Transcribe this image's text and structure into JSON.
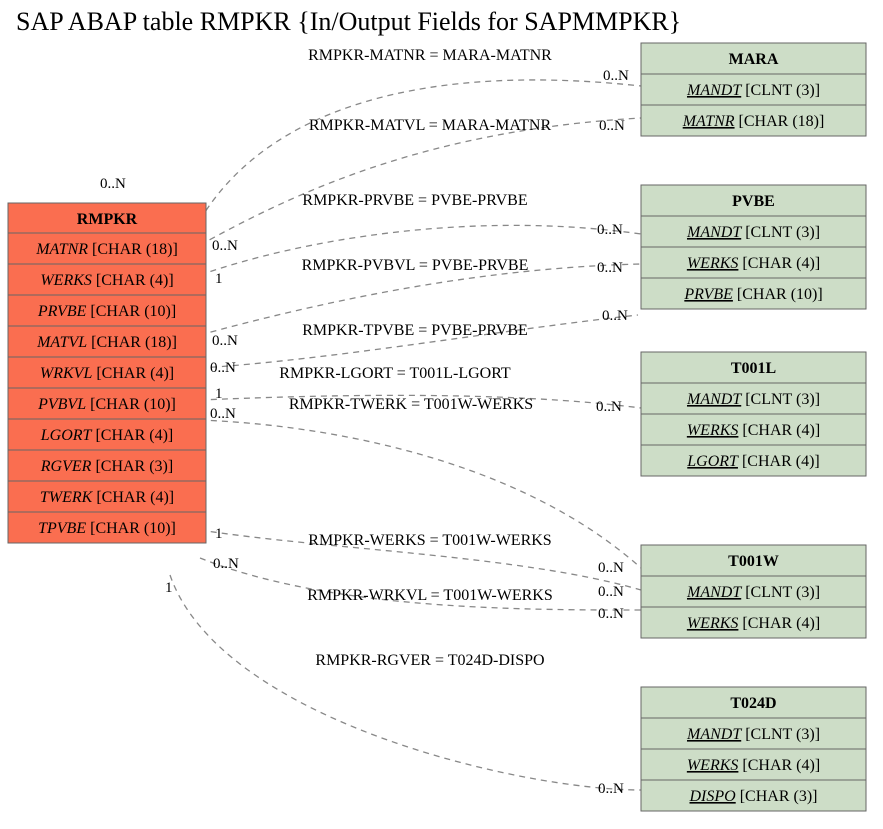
{
  "title": "SAP ABAP table RMPKR {In/Output Fields for SAPMMPKR}",
  "main_table": {
    "name": "RMPKR",
    "fields": [
      {
        "name": "MATNR",
        "type": "[CHAR (18)]"
      },
      {
        "name": "WERKS",
        "type": "[CHAR (4)]"
      },
      {
        "name": "PRVBE",
        "type": "[CHAR (10)]"
      },
      {
        "name": "MATVL",
        "type": "[CHAR (18)]"
      },
      {
        "name": "WRKVL",
        "type": "[CHAR (4)]"
      },
      {
        "name": "PVBVL",
        "type": "[CHAR (10)]"
      },
      {
        "name": "LGORT",
        "type": "[CHAR (4)]"
      },
      {
        "name": "RGVER",
        "type": "[CHAR (3)]"
      },
      {
        "name": "TWERK",
        "type": "[CHAR (4)]"
      },
      {
        "name": "TPVBE",
        "type": "[CHAR (10)]"
      }
    ]
  },
  "ref_tables": [
    {
      "name": "MARA",
      "fields": [
        {
          "name": "MANDT",
          "type": "[CLNT (3)]"
        },
        {
          "name": "MATNR",
          "type": "[CHAR (18)]"
        }
      ]
    },
    {
      "name": "PVBE",
      "fields": [
        {
          "name": "MANDT",
          "type": "[CLNT (3)]"
        },
        {
          "name": "WERKS",
          "type": "[CHAR (4)]"
        },
        {
          "name": "PRVBE",
          "type": "[CHAR (10)]"
        }
      ]
    },
    {
      "name": "T001L",
      "fields": [
        {
          "name": "MANDT",
          "type": "[CLNT (3)]"
        },
        {
          "name": "WERKS",
          "type": "[CHAR (4)]"
        },
        {
          "name": "LGORT",
          "type": "[CHAR (4)]"
        }
      ]
    },
    {
      "name": "T001W",
      "fields": [
        {
          "name": "MANDT",
          "type": "[CLNT (3)]"
        },
        {
          "name": "WERKS",
          "type": "[CHAR (4)]"
        }
      ]
    },
    {
      "name": "T024D",
      "fields": [
        {
          "name": "MANDT",
          "type": "[CLNT (3)]"
        },
        {
          "name": "WERKS",
          "type": "[CHAR (4)]"
        },
        {
          "name": "DISPO",
          "type": "[CHAR (3)]"
        }
      ]
    }
  ],
  "relations": [
    {
      "label": "RMPKR-MATNR = MARA-MATNR",
      "left_card": "0..N",
      "right_card": "0..N"
    },
    {
      "label": "RMPKR-MATVL = MARA-MATNR",
      "left_card": "0..N",
      "right_card": "0..N"
    },
    {
      "label": "RMPKR-PRVBE = PVBE-PRVBE",
      "left_card": "1",
      "right_card": "0..N"
    },
    {
      "label": "RMPKR-PVBVL = PVBE-PRVBE",
      "left_card": "0..N",
      "right_card": "0..N"
    },
    {
      "label": "RMPKR-TPVBE = PVBE-PRVBE",
      "left_card": "0..N",
      "right_card": "0..N"
    },
    {
      "label": "RMPKR-LGORT = T001L-LGORT",
      "left_card": "1",
      "right_card": "0..N"
    },
    {
      "label": "RMPKR-TWERK = T001W-WERKS",
      "left_card": "0..N",
      "right_card": "0..N"
    },
    {
      "label": "RMPKR-WERKS = T001W-WERKS",
      "left_card": "1",
      "right_card": "0..N"
    },
    {
      "label": "RMPKR-WRKVL = T001W-WERKS",
      "left_card": "0..N",
      "right_card": "0..N"
    },
    {
      "label": "RMPKR-RGVER = T024D-DISPO",
      "left_card": "1",
      "right_card": "0..N"
    }
  ]
}
